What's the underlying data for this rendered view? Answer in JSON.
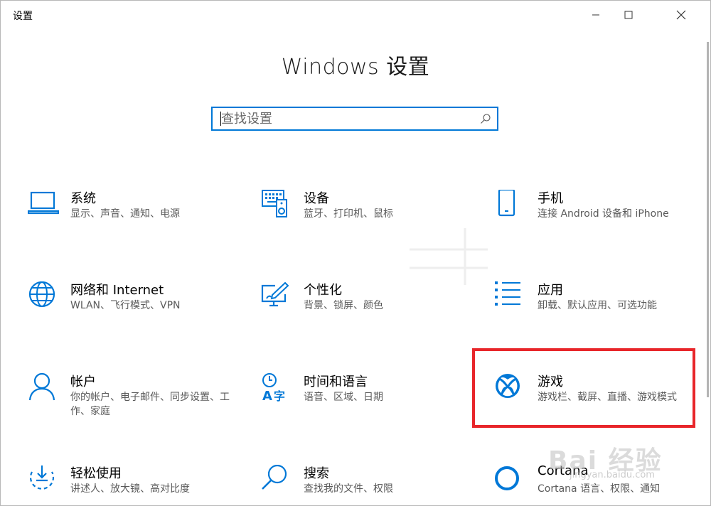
{
  "window": {
    "title": "设置"
  },
  "page": {
    "title": "Windows 设置"
  },
  "search": {
    "placeholder": "查找设置"
  },
  "tiles": [
    {
      "title": "系统",
      "desc": "显示、声音、通知、电源",
      "icon": "laptop-icon"
    },
    {
      "title": "设备",
      "desc": "蓝牙、打印机、鼠标",
      "icon": "devices-icon"
    },
    {
      "title": "手机",
      "desc": "连接 Android 设备和 iPhone",
      "icon": "phone-icon"
    },
    {
      "title": "网络和 Internet",
      "desc": "WLAN、飞行模式、VPN",
      "icon": "globe-icon"
    },
    {
      "title": "个性化",
      "desc": "背景、锁屏、颜色",
      "icon": "personalization-icon"
    },
    {
      "title": "应用",
      "desc": "卸载、默认应用、可选功能",
      "icon": "apps-list-icon"
    },
    {
      "title": "帐户",
      "desc": "你的帐户、电子邮件、同步设置、工作、家庭",
      "icon": "person-icon"
    },
    {
      "title": "时间和语言",
      "desc": "语音、区域、日期",
      "icon": "time-language-icon"
    },
    {
      "title": "游戏",
      "desc": "游戏栏、截屏、直播、游戏模式",
      "icon": "xbox-icon"
    },
    {
      "title": "轻松使用",
      "desc": "讲述人、放大镜、高对比度",
      "icon": "ease-of-access-icon"
    },
    {
      "title": "搜索",
      "desc": "查找我的文件、权限",
      "icon": "search-icon"
    },
    {
      "title": "Cortana",
      "desc": "Cortana 语言、权限、通知",
      "icon": "cortana-icon"
    }
  ],
  "watermark": {
    "logo": "Bai 经验",
    "url": "jingyan.baidu.com"
  },
  "colors": {
    "accent": "#0078d7",
    "highlight": "#e8262a"
  }
}
